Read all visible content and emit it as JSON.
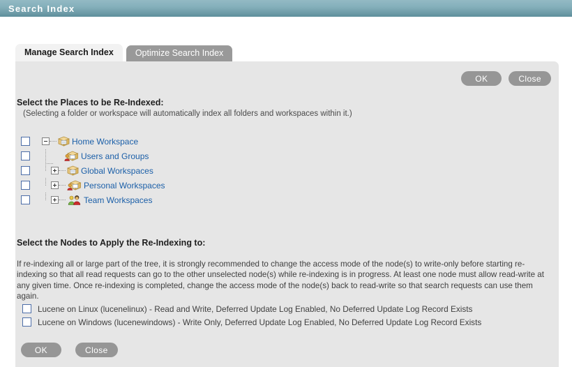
{
  "window": {
    "title": "Search Index",
    "titlebar_color": "#6f9caa"
  },
  "tabs": [
    {
      "label": "Manage Search Index",
      "active": true
    },
    {
      "label": "Optimize Search Index",
      "active": false
    }
  ],
  "toolbar": {
    "ok_label": "OK",
    "close_label": "Close"
  },
  "places_section": {
    "heading": "Select the Places to be Re-Indexed:",
    "subtext": "(Selecting a folder or workspace will automatically index all folders and workspaces within it.)",
    "tree": [
      {
        "label": "Home Workspace",
        "icon": "box-icon",
        "expander": "minus",
        "depth": 0,
        "checked": false
      },
      {
        "label": "Users and Groups",
        "icon": "box-person-icon",
        "expander": "none",
        "depth": 1,
        "checked": false
      },
      {
        "label": "Global Workspaces",
        "icon": "box-icon",
        "expander": "plus",
        "depth": 1,
        "checked": false
      },
      {
        "label": "Personal Workspaces",
        "icon": "box-person-icon",
        "expander": "plus",
        "depth": 1,
        "checked": false
      },
      {
        "label": "Team Workspaces",
        "icon": "two-people-icon",
        "expander": "plus",
        "depth": 1,
        "checked": false
      }
    ]
  },
  "nodes_section": {
    "heading": "Select the Nodes to Apply the Re-Indexing to:",
    "paragraph": "If re-indexing all or large part of the tree, it is strongly recommended to change the access mode of the node(s) to write-only before starting re-indexing so that all read requests can go to the other unselected node(s) while re-indexing is in progress. At least one node must allow read-write at any given time. Once re-indexing is completed, change the access mode of the node(s) back to read-write so that search requests can use them again.",
    "nodes": [
      {
        "label": "Lucene on Linux (lucenelinux) - Read and Write, Deferred Update Log Enabled, No Deferred Update Log Record Exists",
        "checked": false
      },
      {
        "label": "Lucene on Windows (lucenewindows) - Write Only, Deferred Update Log Enabled, No Deferred Update Log Record Exists",
        "checked": false
      }
    ]
  },
  "footer": {
    "ok_label": "OK",
    "close_label": "Close"
  },
  "colors": {
    "link": "#1b5fa8",
    "panel_bg": "#e6e6e6",
    "button_gray": "#969696",
    "inactive_tab": "#999999"
  }
}
